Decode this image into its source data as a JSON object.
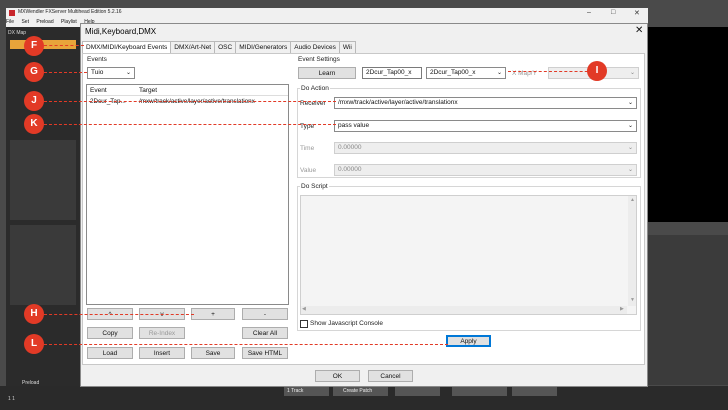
{
  "bg_app": {
    "title": "MXWendler FXServer Multihead Edition 5.2.16",
    "menu": [
      "File",
      "Set",
      "Preload",
      "Playlist",
      "Help"
    ],
    "left_panel_label": "DX Map",
    "preload_label": "Preload",
    "bottom_btn_1": "1 Track",
    "bottom_btn_2": "Create Patch",
    "bottom_number": "1 1"
  },
  "dialog": {
    "title": "Midi,Keyboard,DMX",
    "tabs": [
      "DMX/MIDI/Keyboard Events",
      "DMX/Art-Net",
      "OSC",
      "MIDI/Generators",
      "Audio Devices",
      "Wii"
    ],
    "events": {
      "label": "Events",
      "source": "Tuio",
      "col_event": "Event",
      "col_target": "Target",
      "row_event": "2Dcur_Tap...",
      "row_target": "/mxw/track/active/layer/active/translationx",
      "move_buttons": [
        "^",
        "v",
        "+",
        "-"
      ],
      "copy": "Copy",
      "reindex": "Re-Index",
      "clear_all": "Clear All",
      "load": "Load",
      "insert": "Insert",
      "save": "Save",
      "save_html": "Save HTML"
    },
    "settings": {
      "label": "Event Settings",
      "learn": "Learn",
      "event_name": "2Dcur_Tap00_x",
      "event_combo": "2Dcur_Tap00_x",
      "x_map": "X Map/Y",
      "do_action": "Do Action",
      "receiver_label": "Receiver",
      "receiver_value": "/mxw/track/active/layer/active/translationx",
      "type_label": "Type",
      "type_value": "pass value",
      "time_label": "Time",
      "time_value": "0.00000",
      "value_label": "Value",
      "value_value": "0.00000",
      "do_script": "Do Script",
      "show_console": "Show Javascript Console",
      "apply": "Apply"
    },
    "ok": "OK",
    "cancel": "Cancel"
  },
  "annotations": {
    "F": "F",
    "G": "G",
    "H": "H",
    "I": "I",
    "J": "J",
    "K": "K",
    "L": "L",
    "color": "#e23a26"
  }
}
